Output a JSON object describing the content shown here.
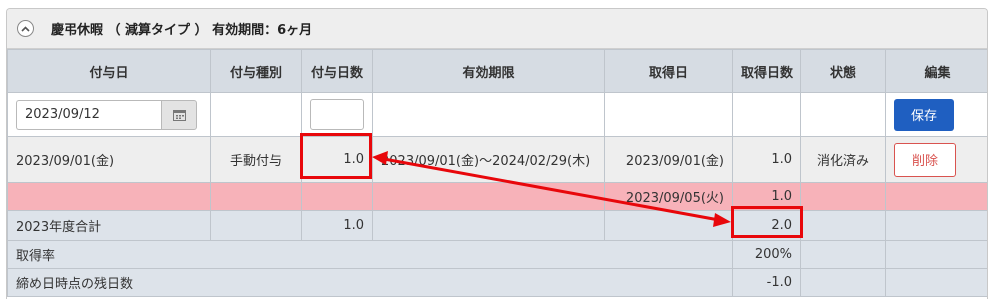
{
  "panel": {
    "title": "慶弔休暇 （ 減算タイプ ） 有効期間：6ヶ月"
  },
  "columns": [
    "付与日",
    "付与種別",
    "付与日数",
    "有効期限",
    "取得日",
    "取得日数",
    "状態",
    "編集"
  ],
  "input_row": {
    "date_value": "2023/09/12",
    "days_value": "",
    "save_label": "保存"
  },
  "grant_row": {
    "grant_date": "2023/09/01(金)",
    "grant_type": "手動付与",
    "grant_days": "1.0",
    "validity": "2023/09/01(金)～2024/02/29(木)",
    "acquired_date": "2023/09/01(金)",
    "acquired_days": "1.0",
    "status": "消化済み",
    "delete_label": "削除"
  },
  "usage_row": {
    "acquired_date": "2023/09/05(火)",
    "acquired_days": "1.0"
  },
  "total_row": {
    "label": "2023年度合計",
    "grant_days": "1.0",
    "acquired_days": "2.0"
  },
  "rate_row": {
    "label": "取得率",
    "value": "200%"
  },
  "remaining_row": {
    "label": "締め日時点の残日数",
    "value": "-1.0"
  },
  "colors": {
    "header_bg": "#d6dce3",
    "usage_row_bg": "#f7b2b9",
    "summary_bg": "#dde3ea",
    "save_button": "#1f5fc1",
    "delete_button": "#d9534f",
    "annotation": "#e8070b"
  },
  "icons": {
    "collapse": "chevron-up-icon",
    "calendar": "calendar-icon"
  }
}
